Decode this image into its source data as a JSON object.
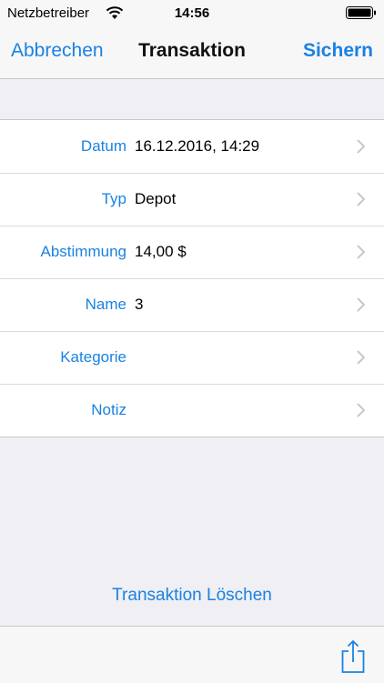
{
  "status_bar": {
    "carrier": "Netzbetreiber",
    "time": "14:56"
  },
  "nav": {
    "cancel_label": "Abbrechen",
    "title": "Transaktion",
    "save_label": "Sichern"
  },
  "form": {
    "rows": [
      {
        "label": "Datum",
        "value": "16.12.2016, 14:29"
      },
      {
        "label": "Typ",
        "value": "Depot"
      },
      {
        "label": "Abstimmung",
        "value": "14,00 $"
      },
      {
        "label": "Name",
        "value": "3"
      },
      {
        "label": "Kategorie",
        "value": ""
      },
      {
        "label": "Notiz",
        "value": ""
      }
    ]
  },
  "actions": {
    "delete_label": "Transaktion Löschen"
  },
  "toolbar": {
    "share_icon": "share-icon"
  },
  "colors": {
    "accent": "#1a82e2",
    "background": "#efeff4",
    "bar": "#f7f7f7",
    "separator": "#c8c7cc"
  }
}
